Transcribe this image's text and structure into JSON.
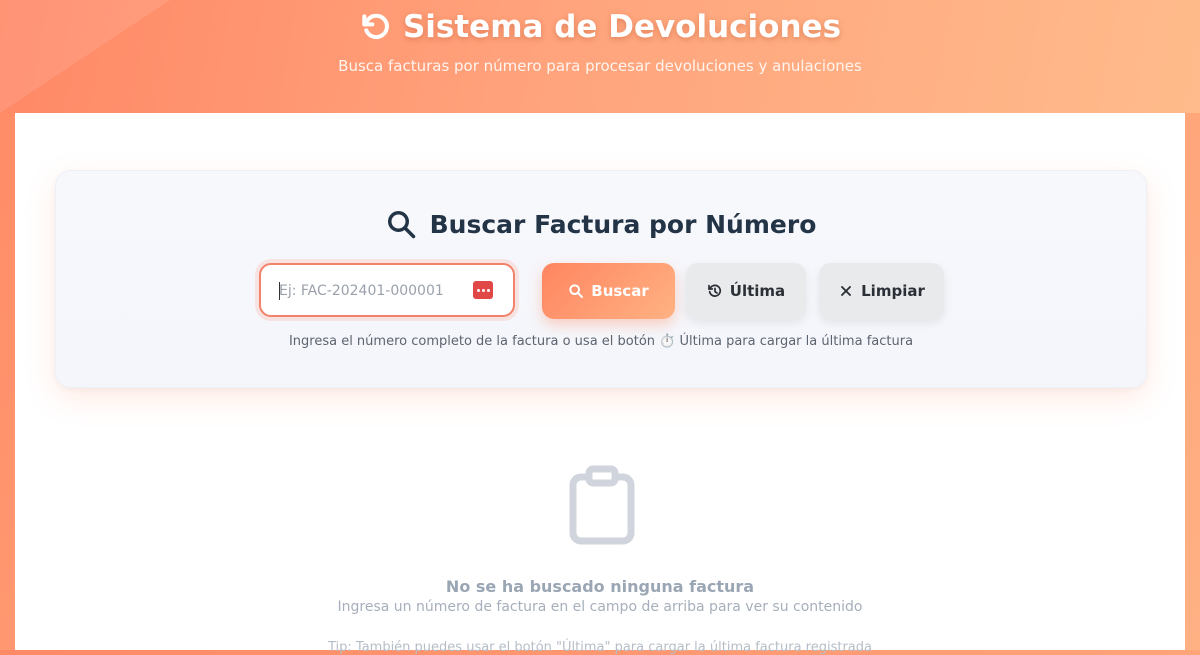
{
  "header": {
    "title": "Sistema de Devoluciones",
    "subtitle": "Busca facturas por número para procesar devoluciones y anulaciones",
    "icon": "undo-icon"
  },
  "search": {
    "title": "Buscar Factura por Número",
    "input_placeholder": "Ej: FAC-202401-000001",
    "input_value": "",
    "buttons": {
      "search_label": "Buscar",
      "last_label": "Última",
      "clear_label": "Limpiar"
    },
    "hint": "Ingresa el número completo de la factura o usa el botón ⏱️ Última para cargar la última factura"
  },
  "empty_state": {
    "icon": "clipboard-icon",
    "title": "No se ha buscado ninguna factura",
    "subtitle": "Ingresa un número de factura en el campo de arriba para ver su contenido",
    "tip": "Tip: También puedes usar el botón \"Última\" para cargar la última factura registrada"
  },
  "colors": {
    "accent": "#ff8a65",
    "accent_light": "#ffb184",
    "input_border": "#f2826a",
    "title_text": "#243447"
  }
}
